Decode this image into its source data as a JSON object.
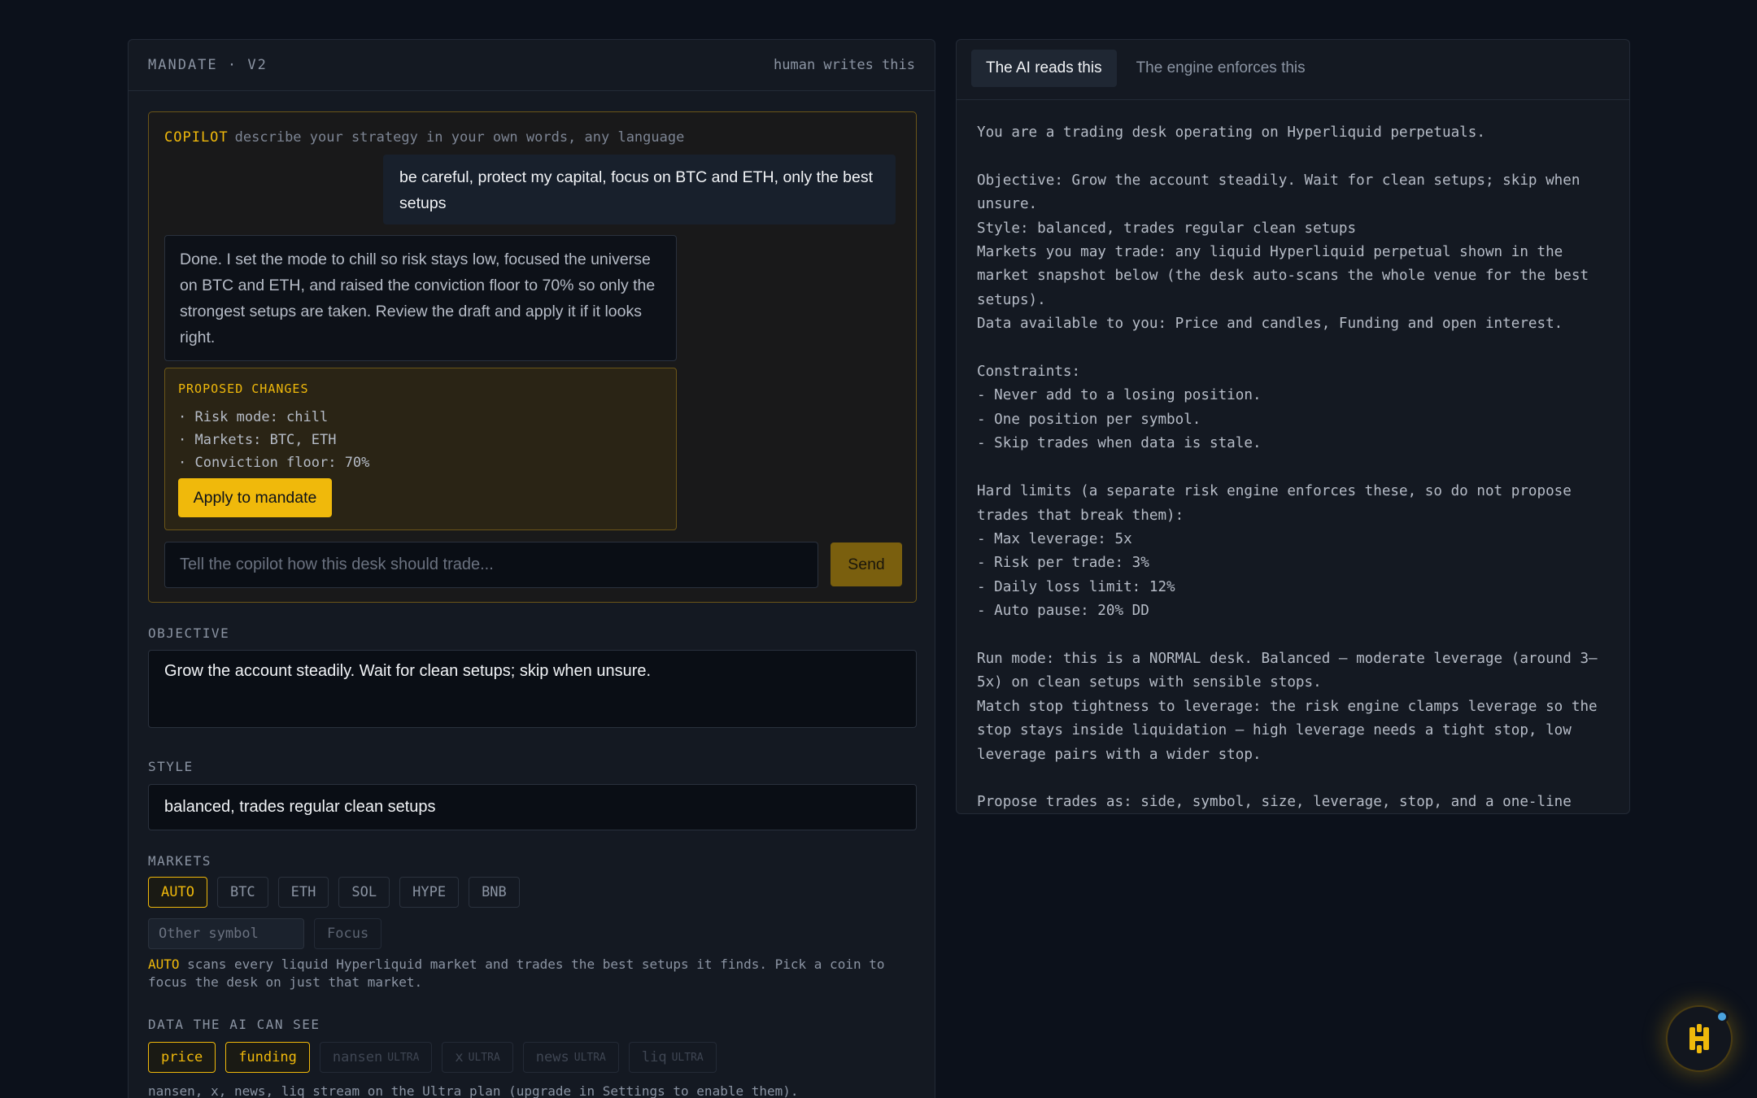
{
  "mandate": {
    "title": "MANDATE · V2",
    "subtitle": "human writes this"
  },
  "copilot": {
    "tag": "COPILOT",
    "description": "describe your strategy in your own words, any language",
    "user_message": "be careful, protect my capital, focus on BTC and ETH, only the best setups",
    "ai_message": "Done. I set the mode to chill so risk stays low, focused the universe on BTC and ETH, and raised the conviction floor to 70% so only the strongest setups are taken. Review the draft and apply it if it looks right.",
    "proposal_title": "PROPOSED CHANGES",
    "proposal_items": [
      "· Risk mode: chill",
      "· Markets: BTC, ETH",
      "· Conviction floor: 70%"
    ],
    "apply_label": "Apply to mandate",
    "input_placeholder": "Tell the copilot how this desk should trade...",
    "send_label": "Send"
  },
  "objective": {
    "label": "OBJECTIVE",
    "value": "Grow the account steadily. Wait for clean setups; skip when unsure."
  },
  "style": {
    "label": "STYLE",
    "value": "balanced, trades regular clean setups"
  },
  "markets": {
    "label": "MARKETS",
    "chips": [
      "AUTO",
      "BTC",
      "ETH",
      "SOL",
      "HYPE",
      "BNB"
    ],
    "other_placeholder": "Other symbol",
    "focus_label": "Focus",
    "hint_highlight": "AUTO",
    "hint_text": " scans every liquid Hyperliquid market and trades the best setups it finds. Pick a coin to focus the desk on just that market."
  },
  "data_sources": {
    "label": "DATA THE AI CAN SEE",
    "active": [
      "price",
      "funding"
    ],
    "ultra": [
      "nansen",
      "x",
      "news",
      "liq"
    ],
    "ultra_tag": "ULTRA",
    "hint": "nansen, x, news, liq stream on the Ultra plan (upgrade in Settings to enable them)."
  },
  "right_panel": {
    "tabs": [
      "The AI reads this",
      "The engine enforces this"
    ],
    "prompt": "You are a trading desk operating on Hyperliquid perpetuals.\n\nObjective: Grow the account steadily. Wait for clean setups; skip when\nunsure.\nStyle: balanced, trades regular clean setups\nMarkets you may trade: any liquid Hyperliquid perpetual shown in the\nmarket snapshot below (the desk auto-scans the whole venue for the best\nsetups).\nData available to you: Price and candles, Funding and open interest.\n\nConstraints:\n- Never add to a losing position.\n- One position per symbol.\n- Skip trades when data is stale.\n\nHard limits (a separate risk engine enforces these, so do not propose\ntrades that break them):\n- Max leverage: 5x\n- Risk per trade: 3%\n- Daily loss limit: 12%\n- Auto pause: 20% DD\n\nRun mode: this is a NORMAL desk. Balanced — moderate leverage (around 3–\n5x) on clean setups with sensible stops.\nMatch stop tightness to leverage: the risk engine clamps leverage so the\nstop stays inside liquidation — high leverage needs a tight stop, low\nleverage pairs with a wider stop.\n\nPropose trades as: side, symbol, size, leverage, stop, and a one-line"
  },
  "colors": {
    "accent": "#f0b90b",
    "background": "#0c111b",
    "panel": "#141922"
  }
}
